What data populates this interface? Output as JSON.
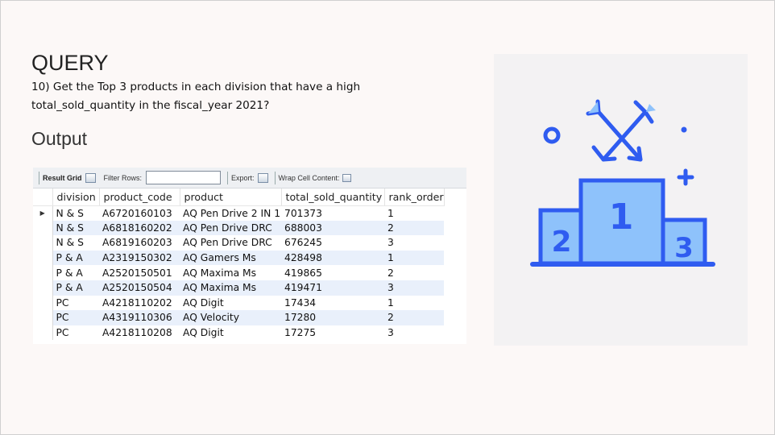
{
  "slide": {
    "heading": "QUERY",
    "question_line1": "10) Get the Top 3 products in each division that have a high",
    "question_line2": "total_sold_quantity in the fiscal_year 2021?",
    "output_label": "Output"
  },
  "toolbar": {
    "result_grid": "Result Grid",
    "filter_rows": "Filter Rows:",
    "filter_value": "",
    "export": "Export:",
    "wrap_cell": "Wrap Cell Content:"
  },
  "table": {
    "columns": [
      "division",
      "product_code",
      "product",
      "total_sold_quantity",
      "rank_order"
    ],
    "rows": [
      [
        "N & S",
        "A6720160103",
        "AQ Pen Drive 2 IN 1",
        "701373",
        "1"
      ],
      [
        "N & S",
        "A6818160202",
        "AQ Pen Drive DRC",
        "688003",
        "2"
      ],
      [
        "N & S",
        "A6819160203",
        "AQ Pen Drive DRC",
        "676245",
        "3"
      ],
      [
        "P & A",
        "A2319150302",
        "AQ Gamers Ms",
        "428498",
        "1"
      ],
      [
        "P & A",
        "A2520150501",
        "AQ Maxima Ms",
        "419865",
        "2"
      ],
      [
        "P & A",
        "A2520150504",
        "AQ Maxima Ms",
        "419471",
        "3"
      ],
      [
        "PC",
        "A4218110202",
        "AQ Digit",
        "17434",
        "1"
      ],
      [
        "PC",
        "A4319110306",
        "AQ Velocity",
        "17280",
        "2"
      ],
      [
        "PC",
        "A4218110208",
        "AQ Digit",
        "17275",
        "3"
      ]
    ]
  },
  "illustration": {
    "icon": "podium-icon",
    "accent": "#2f5cf0",
    "fill_light": "#8ec2fb",
    "podium_labels": [
      "2",
      "1",
      "3"
    ]
  }
}
